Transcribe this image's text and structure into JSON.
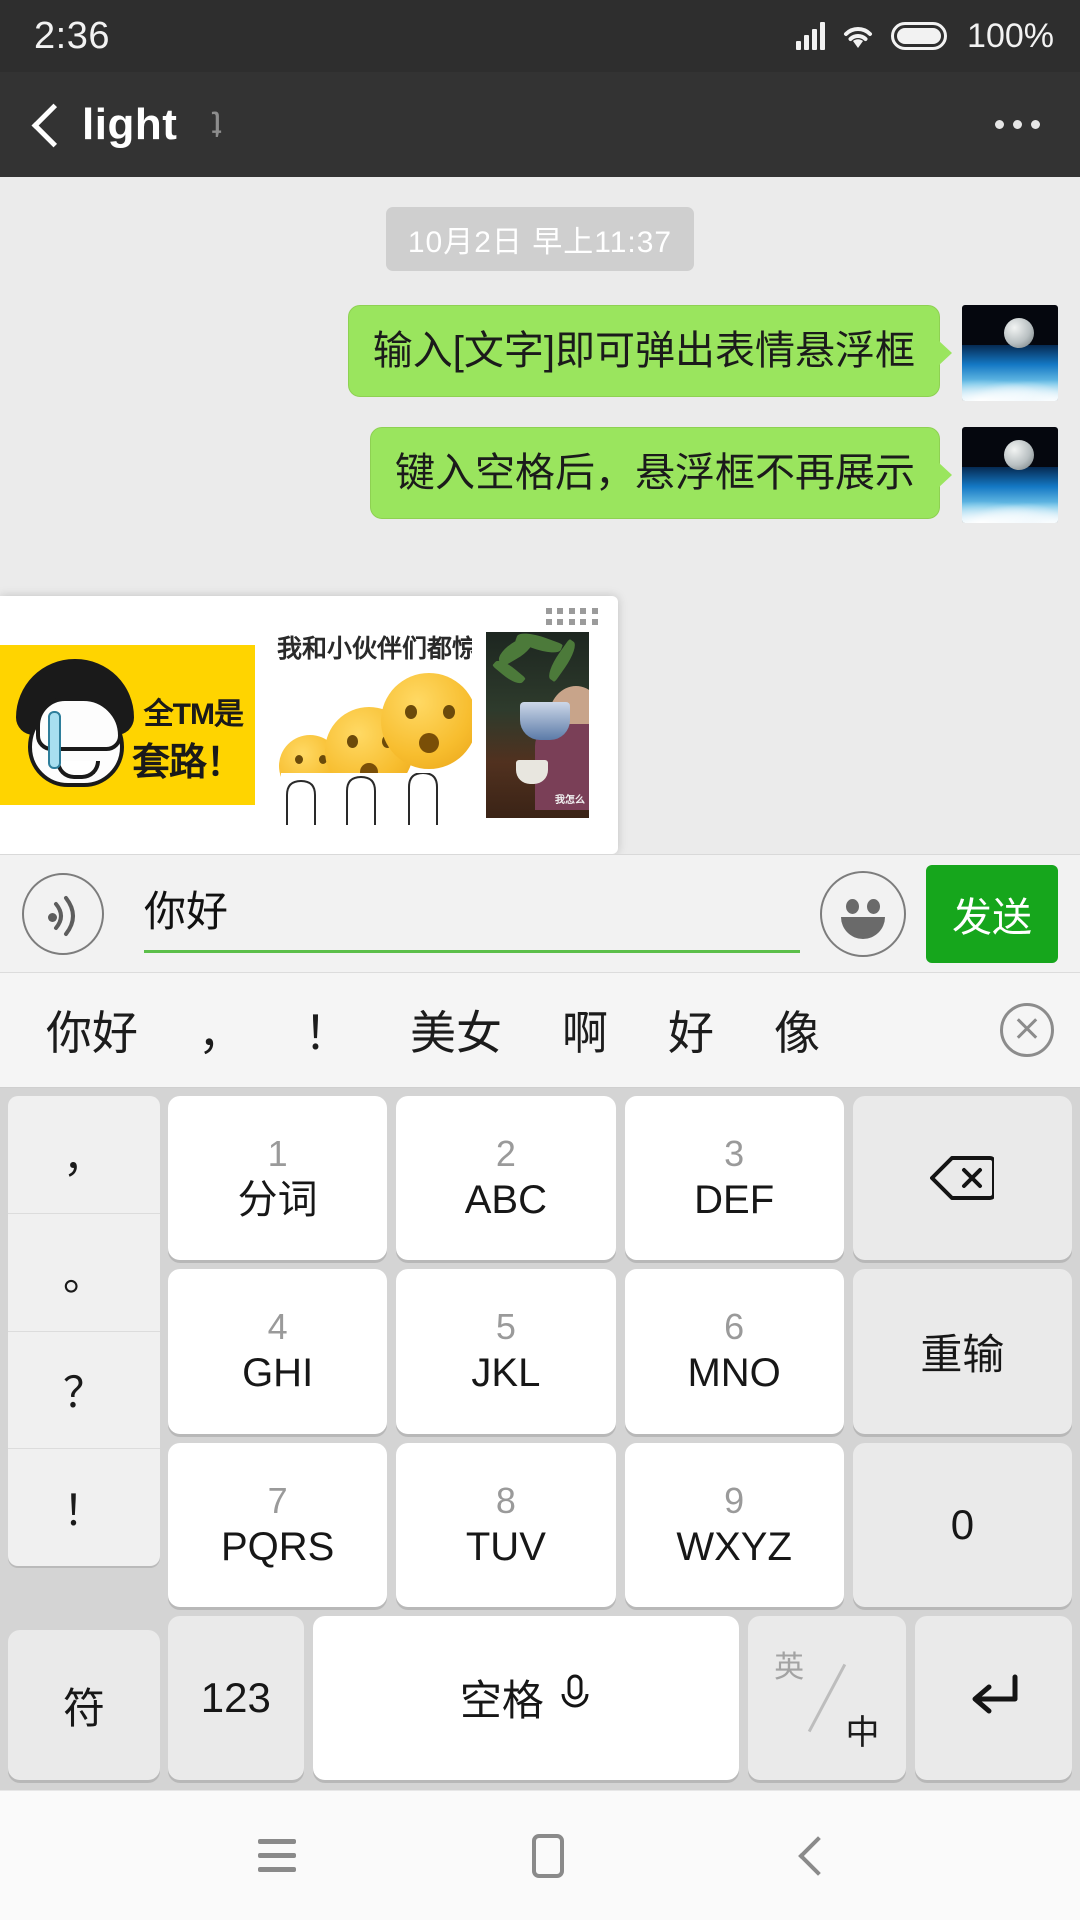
{
  "statusbar": {
    "time": "2:36",
    "battery_text": "100%",
    "signal_icon": "signal-bars-icon",
    "wifi_icon": "wifi-icon",
    "battery_icon": "battery-full-icon"
  },
  "header": {
    "back_icon": "back-chevron-icon",
    "title": "light",
    "title_badge_glyph": "ʇ",
    "menu_icon": "overflow-menu-icon"
  },
  "chat": {
    "date_divider": "10月2日 早上11:37",
    "messages": [
      {
        "text": "输入[文字]即可弹出表情悬浮框",
        "side": "outgoing"
      },
      {
        "text": "键入空格后，悬浮框不再展示",
        "side": "outgoing"
      }
    ],
    "bubble_color": "#9ae55e",
    "avatar_name": "moon-over-earth-avatar"
  },
  "sticker_panel": {
    "handle_icon": "grid-drag-handle-icon",
    "stickers": [
      {
        "name": "crying-girl-meme",
        "line1": "全TM是",
        "line2": "套路！"
      },
      {
        "name": "shocked-emoji-group",
        "caption": "我和小伙伴们都惊呆了！"
      },
      {
        "name": "tea-scene-photo",
        "caption": "我怎么"
      }
    ]
  },
  "inputbar": {
    "voice_icon": "voice-input-icon",
    "input_value": "你好",
    "input_placeholder": "",
    "emoji_icon": "emoji-face-icon",
    "send_label": "发送",
    "send_color": "#16a61c",
    "underline_color": "#5cbf4a"
  },
  "candidates": {
    "items": [
      "你好",
      "，",
      "！",
      "美女",
      "啊",
      "好",
      "像"
    ],
    "close_icon": "close-candidates-icon"
  },
  "keyboard": {
    "punctuation": [
      "，",
      "。",
      "？",
      "！"
    ],
    "rows": [
      [
        {
          "num": "1",
          "sub": "分词",
          "name": "key-1"
        },
        {
          "num": "2",
          "sub": "ABC",
          "name": "key-2"
        },
        {
          "num": "3",
          "sub": "DEF",
          "name": "key-3"
        },
        {
          "icon": "backspace-icon",
          "name": "key-backspace"
        }
      ],
      [
        {
          "num": "4",
          "sub": "GHI",
          "name": "key-4"
        },
        {
          "num": "5",
          "sub": "JKL",
          "name": "key-5"
        },
        {
          "num": "6",
          "sub": "MNO",
          "name": "key-6"
        },
        {
          "label": "重输",
          "name": "key-redo"
        }
      ],
      [
        {
          "num": "7",
          "sub": "PQRS",
          "name": "key-7"
        },
        {
          "num": "8",
          "sub": "TUV",
          "name": "key-8"
        },
        {
          "num": "9",
          "sub": "WXYZ",
          "name": "key-9"
        },
        {
          "label": "0",
          "name": "key-0"
        }
      ]
    ],
    "bottom": {
      "symbol_label": "符",
      "numeric_label": "123",
      "space_label": "空格",
      "space_mic_icon": "microphone-icon",
      "lang_en": "英",
      "lang_cn": "中",
      "enter_icon": "enter-return-icon"
    }
  },
  "navbar": {
    "menu_icon": "nav-menu-icon",
    "home_icon": "nav-home-icon",
    "back_icon": "nav-back-icon"
  }
}
